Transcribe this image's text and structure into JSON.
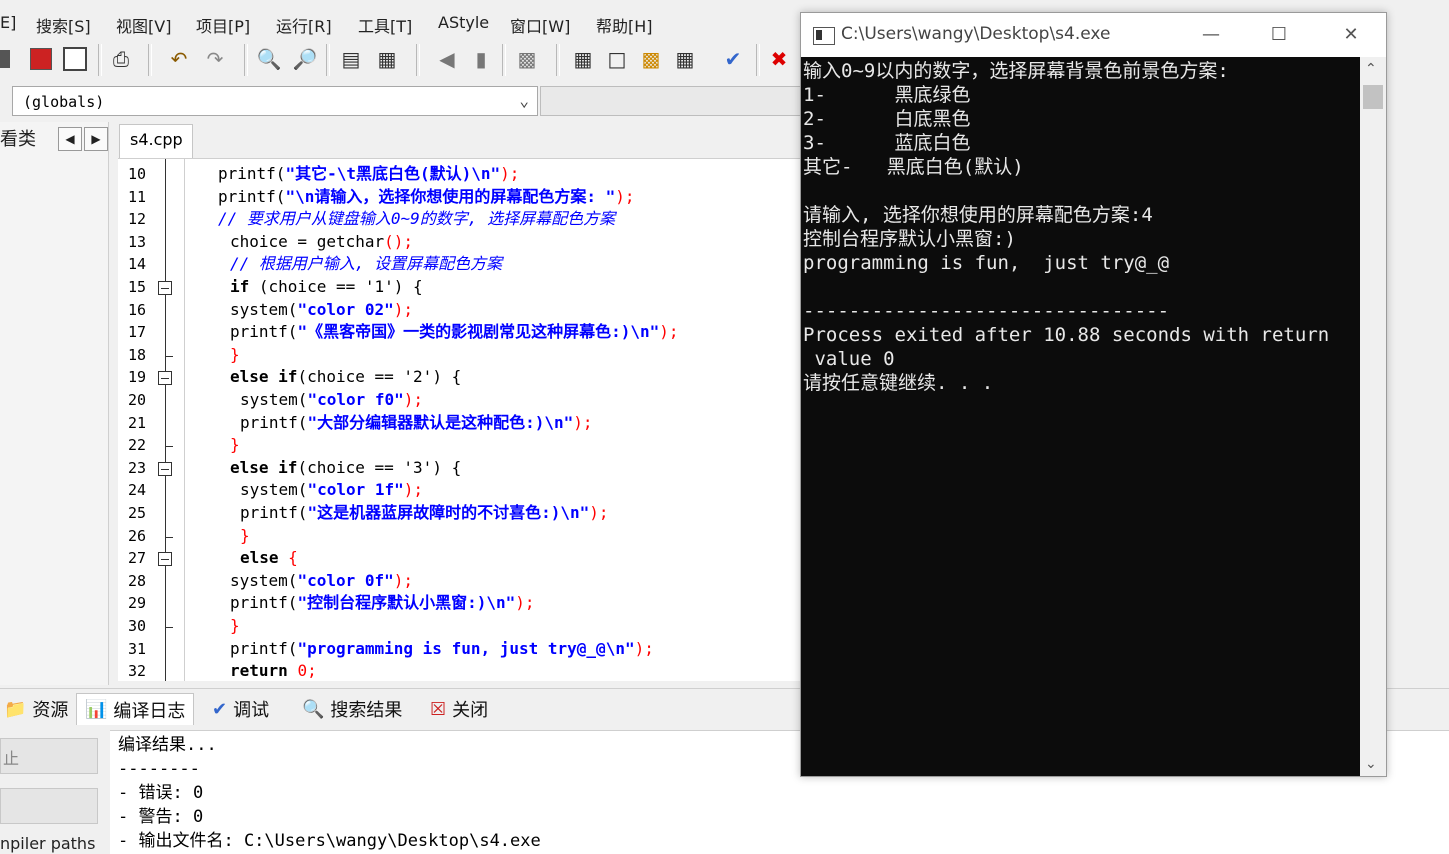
{
  "menu": {
    "items": [
      "E]",
      "搜索[S]",
      "视图[V]",
      "项目[P]",
      "运行[R]",
      "工具[T]",
      "AStyle",
      "窗口[W]",
      "帮助[H]"
    ]
  },
  "toolbar": {
    "icons": [
      "compile-icon",
      "stop-icon",
      "print-icon",
      "undo-icon",
      "redo-icon",
      "find-icon",
      "replace-icon",
      "indent-icon",
      "unindent-icon",
      "bookmark-icon",
      "toggle-icon",
      "layout-icon",
      "window-icon",
      "colors-icon",
      "grid-icon",
      "check-icon",
      "close-icon"
    ]
  },
  "globals": {
    "value": "(globals)"
  },
  "class_panel": {
    "tab_label": "看类"
  },
  "editor": {
    "file_tab": "s4.cpp",
    "line_numbers": [
      "10",
      "11",
      "12",
      "13",
      "14",
      "15",
      "16",
      "17",
      "18",
      "19",
      "20",
      "21",
      "22",
      "23",
      "24",
      "25",
      "26",
      "27",
      "28",
      "29",
      "30",
      "31",
      "32"
    ]
  },
  "code": {
    "l10_fn": "printf(",
    "l10_str": "\"其它-\\t黑底白色(默认)\\n\"",
    "l10_end": ");",
    "l11_fn": "printf(",
    "l11_str": "\"\\n请输入，选择你想使用的屏幕配色方案: \"",
    "l11_end": ");",
    "l12_cmt": "// 要求用户从键盘输入0~9的数字, 选择屏幕配色方案",
    "l13_a": "choice = getchar",
    "l13_b": "();",
    "l14_cmt": "// 根据用户输入, 设置屏幕配色方案",
    "l15_kw": "if",
    "l15_a": " (choice == ",
    "l15_chr": "'1'",
    "l15_b": ") {",
    "l16_fn": "system(",
    "l16_str": "\"color 02\"",
    "l16_end": ");",
    "l17_fn": "printf(",
    "l17_str": "\"《黑客帝国》一类的影视剧常见这种屏幕色:)\\n\"",
    "l17_end": ");",
    "l18": "}",
    "l19_kw": "else if",
    "l19_a": "(choice == ",
    "l19_chr": "'2'",
    "l19_b": ") {",
    "l20_fn": "system(",
    "l20_str": "\"color f0\"",
    "l20_end": ");",
    "l21_fn": "printf(",
    "l21_str": "\"大部分编辑器默认是这种配色:)\\n\"",
    "l21_end": ");",
    "l22": "}",
    "l23_kw": "else if",
    "l23_a": "(choice == ",
    "l23_chr": "'3'",
    "l23_b": ") {",
    "l24_fn": "system(",
    "l24_str": "\"color 1f\"",
    "l24_end": ");",
    "l25_fn": "printf(",
    "l25_str": "\"这是机器蓝屏故障时的不讨喜色:)\\n\"",
    "l25_end": ");",
    "l26": "}",
    "l27_kw": "else",
    "l27_b": " {",
    "l28_fn": "system(",
    "l28_str": "\"color 0f\"",
    "l28_end": ");",
    "l29_fn": "printf(",
    "l29_str": "\"控制台程序默认小黑窗:)\\n\"",
    "l29_end": ");",
    "l30": "}",
    "l31_fn": "printf(",
    "l31_str": "\"programming is fun, just try@_@\\n\"",
    "l31_end": ");",
    "l32_kw": "return",
    "l32_num": "0",
    "l32_end": ";"
  },
  "bottom_tabs": {
    "resources": "资源",
    "compile_log": "编译日志",
    "debug": "调试",
    "search_results": "搜索结果",
    "close": "关闭"
  },
  "bottom_left": {
    "box1": "止",
    "compiler_paths": "npiler paths"
  },
  "log": {
    "lines": [
      "编译结果...",
      "--------",
      "- 错误: 0",
      "- 警告: 0",
      "- 输出文件名: C:\\Users\\wangy\\Desktop\\s4.exe"
    ]
  },
  "console": {
    "title": "C:\\Users\\wangy\\Desktop\\s4.exe",
    "lines": [
      "输入0~9以内的数字，选择屏幕背景色前景色方案:",
      "1-      黑底绿色",
      "2-      白底黑色",
      "3-      蓝底白色",
      "其它-   黑底白色(默认)",
      "",
      "请输入, 选择你想使用的屏幕配色方案:4",
      "控制台程序默认小黑窗:)",
      "programming is fun,  just try@_@",
      "",
      "--------------------------------",
      "Process exited after 10.88 seconds with return",
      " value 0",
      "请按任意键继续. . ."
    ]
  }
}
